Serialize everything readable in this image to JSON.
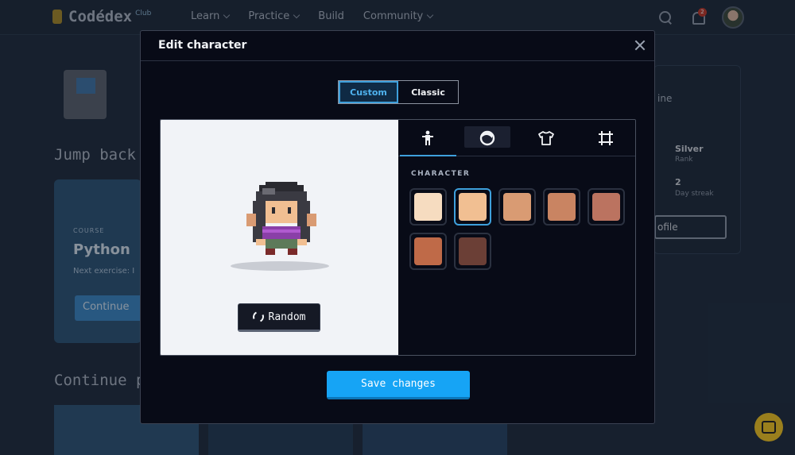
{
  "app": {
    "logo_text": "Codédex",
    "logo_sub": "Club",
    "nav": [
      "Learn",
      "Practice",
      "Build",
      "Community"
    ],
    "notification_count": "2"
  },
  "background": {
    "jump_heading": "Jump back",
    "continue_heading": "Continue p",
    "card": {
      "category": "COURSE",
      "title": "Python",
      "next": "Next exercise: I",
      "button": "Continue"
    },
    "side": {
      "title": "ine",
      "rank_value": "Silver",
      "rank_label": "Rank",
      "streak_value": "2",
      "streak_label": "Day streak",
      "profile_btn": "ofile"
    }
  },
  "modal": {
    "title": "Edit character",
    "segments": {
      "custom": "Custom",
      "classic": "Classic",
      "active": "custom"
    },
    "tabs": [
      {
        "icon": "body-icon",
        "active": true
      },
      {
        "icon": "hair-icon",
        "active": false
      },
      {
        "icon": "shirt-icon",
        "active": false
      },
      {
        "icon": "frame-icon",
        "active": false
      }
    ],
    "section_label": "CHARACTER",
    "skin_tones": [
      {
        "color": "#f6dcc0",
        "selected": false
      },
      {
        "color": "#f1bf92",
        "selected": true
      },
      {
        "color": "#d99b73",
        "selected": false
      },
      {
        "color": "#c98462",
        "selected": false
      },
      {
        "color": "#bb7360",
        "selected": false
      },
      {
        "color": "#bf6a48",
        "selected": false
      },
      {
        "color": "#6b3f36",
        "selected": false
      }
    ],
    "random_label": "Random",
    "save_label": "Save changes"
  }
}
